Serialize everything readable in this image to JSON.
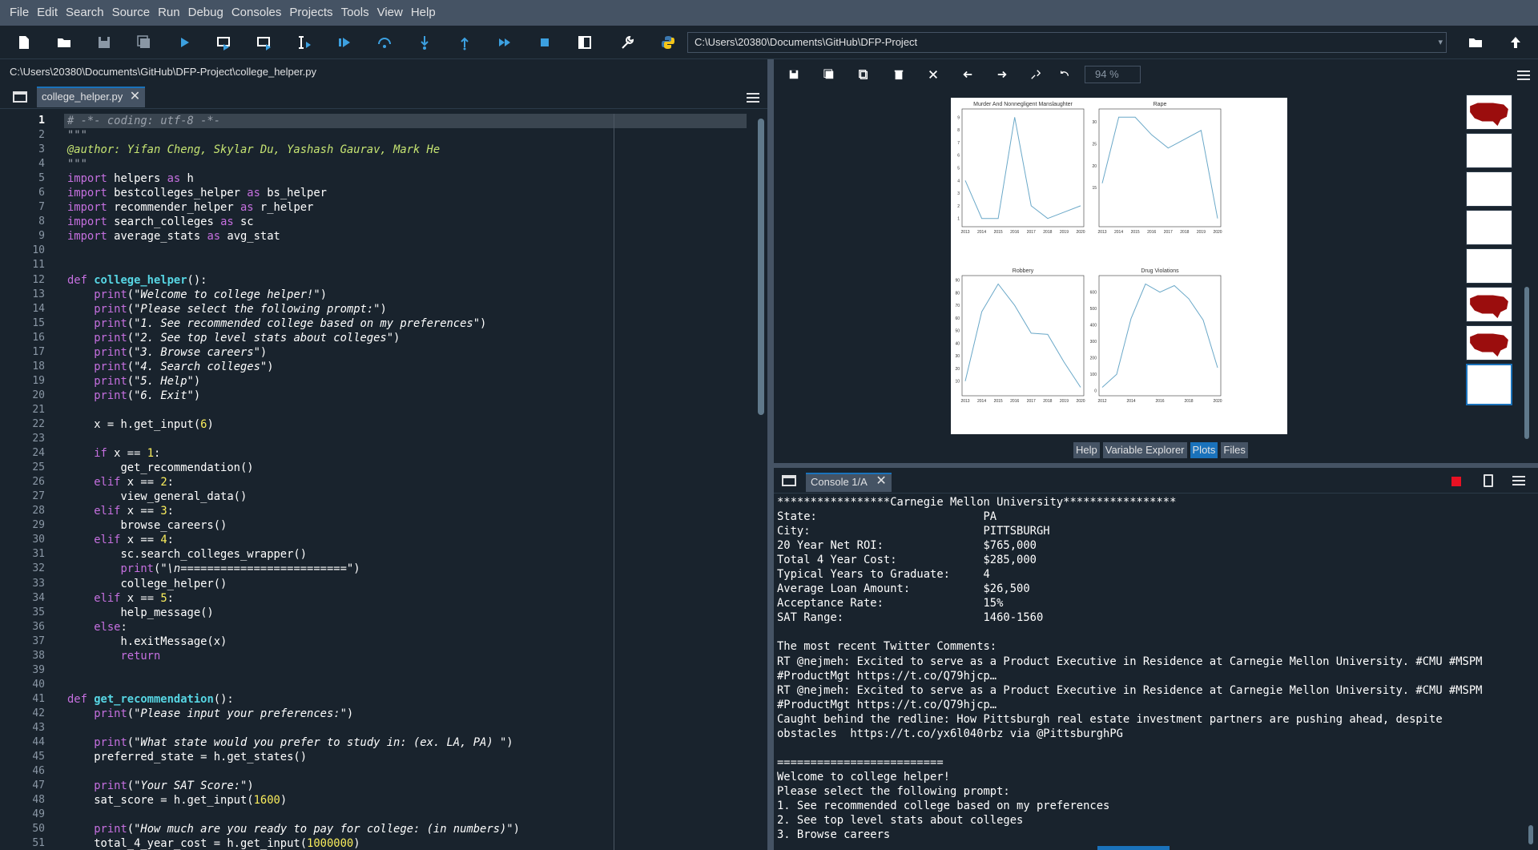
{
  "menu": [
    "File",
    "Edit",
    "Search",
    "Source",
    "Run",
    "Debug",
    "Consoles",
    "Projects",
    "Tools",
    "View",
    "Help"
  ],
  "toolbar": {
    "working_dir": "C:\\Users\\20380\\Documents\\GitHub\\DFP-Project",
    "buttons": [
      "new-file-icon",
      "open-icon",
      "save-icon",
      "save-all-icon",
      "run-icon",
      "run-cell-icon",
      "run-cell-advance-icon",
      "run-selection-icon",
      "debug-icon",
      "step-icon",
      "step-into-icon",
      "step-return-icon",
      "continue-icon",
      "stop-debug-icon",
      "maximize-pane-icon",
      "preferences-icon",
      "python-path-icon"
    ]
  },
  "editor": {
    "file_path": "C:\\Users\\20380\\Documents\\GitHub\\DFP-Project\\college_helper.py",
    "tab_label": "college_helper.py",
    "current_line": 1
  },
  "plots": {
    "zoom": "94 %",
    "tabs": [
      "Help",
      "Variable Explorer",
      "Plots",
      "Files"
    ],
    "active_tab": "Plots",
    "subplots": [
      {
        "title": "Murder And Nonnegligent Manslaughter",
        "x": [
          "2013",
          "2014",
          "2015",
          "2016",
          "2017",
          "2018",
          "2019",
          "2020"
        ],
        "y": [
          4,
          1,
          1,
          9,
          2,
          1,
          1.5,
          2
        ],
        "yticks": [
          "0",
          "1",
          "2",
          "3",
          "4",
          "5",
          "6",
          "7",
          "8",
          "9"
        ]
      },
      {
        "title": "Rape",
        "x": [
          "2013",
          "2014",
          "2015",
          "2016",
          "2017",
          "2018",
          "2019",
          "2020"
        ],
        "y": [
          16,
          31,
          31,
          27,
          24,
          26,
          28,
          8
        ],
        "yticks": [
          "15",
          "20",
          "25",
          "30"
        ]
      },
      {
        "title": "Robbery",
        "x": [
          "2013",
          "2014",
          "2015",
          "2016",
          "2017",
          "2018",
          "2019",
          "2020"
        ],
        "y": [
          10,
          65,
          87,
          70,
          48,
          47,
          25,
          5
        ],
        "yticks": [
          "10",
          "20",
          "30",
          "40",
          "50",
          "60",
          "70",
          "80",
          "90"
        ]
      },
      {
        "title": "Drug Violations",
        "x": [
          "2012",
          "2014",
          "2016",
          "2018",
          "2020"
        ],
        "y": [
          20,
          100,
          440,
          650,
          600,
          640,
          560,
          430,
          140
        ],
        "yticks": [
          "0",
          "100",
          "200",
          "300",
          "400",
          "500",
          "600"
        ]
      }
    ]
  },
  "console": {
    "tab_label": "Console 1/A",
    "lines": [
      "*****************Carnegie Mellon University*****************",
      "State:                         PA",
      "City:                          PITTSBURGH",
      "20 Year Net ROI:               $765,000",
      "Total 4 Year Cost:             $285,000",
      "Typical Years to Graduate:     4",
      "Average Loan Amount:           $26,500",
      "Acceptance Rate:               15%",
      "SAT Range:                     1460-1560",
      "",
      "The most recent Twitter Comments:",
      "RT @nejmeh: Excited to serve as a Product Executive in Residence at Carnegie Mellon University. #CMU #MSPM",
      "#ProductMgt https://t.co/Q79hjcp…",
      "RT @nejmeh: Excited to serve as a Product Executive in Residence at Carnegie Mellon University. #CMU #MSPM",
      "#ProductMgt https://t.co/Q79hjcp…",
      "Caught behind the redline: How Pittsburgh real estate investment partners are pushing ahead, despite",
      "obstacles  https://t.co/yx6l040rbz via @PittsburghPG",
      "",
      "=========================",
      "Welcome to college helper!",
      "Please select the following prompt:",
      "1. See recommended college based on my preferences",
      "2. See top level stats about colleges",
      "3. Browse careers"
    ]
  },
  "colors": {
    "background": "#19232d",
    "menubar": "#455364",
    "accent": "#1a72bb",
    "keyword": "#c670e0",
    "function": "#57d6e4",
    "number": "#faed5c",
    "plot_line": "#6aa8c8"
  }
}
